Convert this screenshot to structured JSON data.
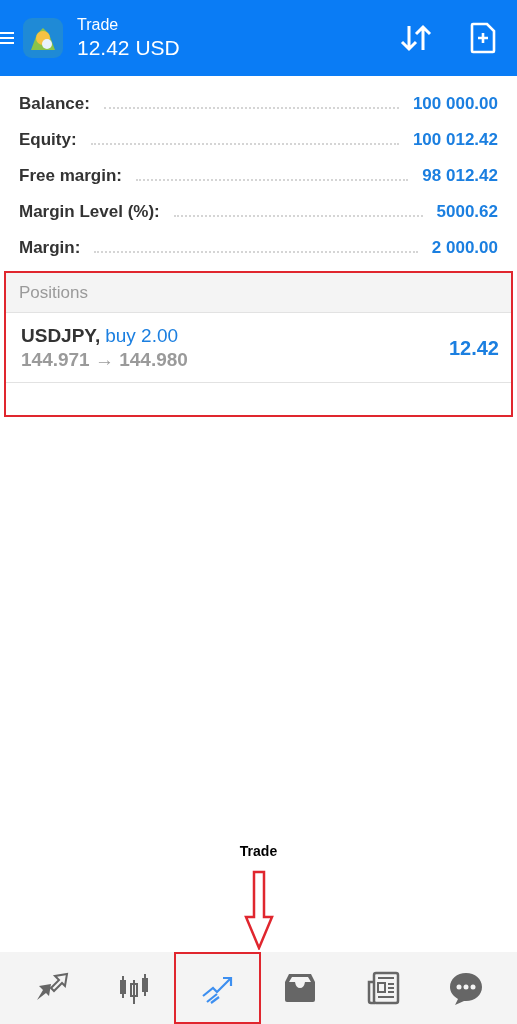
{
  "header": {
    "title": "Trade",
    "balance": "12.42 USD"
  },
  "account": [
    {
      "label": "Balance:",
      "value": "100 000.00"
    },
    {
      "label": "Equity:",
      "value": "100 012.42"
    },
    {
      "label": "Free margin:",
      "value": "98 012.42"
    },
    {
      "label": "Margin Level (%):",
      "value": "5000.62"
    },
    {
      "label": "Margin:",
      "value": "2 000.00"
    }
  ],
  "positions": {
    "title": "Positions",
    "items": [
      {
        "symbol": "USDJPY,",
        "side": "buy 2.00",
        "prices": "144.971 → 144.980",
        "profit": "12.42"
      }
    ]
  },
  "annotation": {
    "label": "Trade"
  },
  "nav": [
    {
      "kind": "quotes",
      "selected": false
    },
    {
      "kind": "chart",
      "selected": false
    },
    {
      "kind": "trade",
      "selected": true
    },
    {
      "kind": "history",
      "selected": false
    },
    {
      "kind": "news",
      "selected": false
    },
    {
      "kind": "chat",
      "selected": false
    }
  ]
}
